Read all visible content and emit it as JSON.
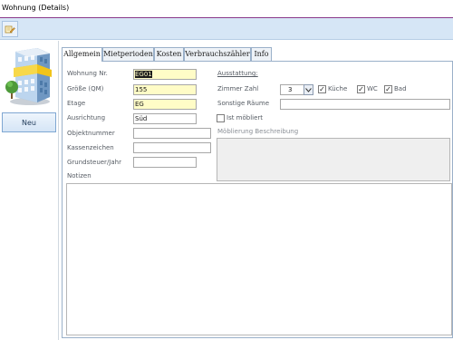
{
  "window": {
    "title": "Wohnung (Details)"
  },
  "toolbar": {
    "icon": "edit-record-icon"
  },
  "left": {
    "new_label": "Neu",
    "image_icon": "apartment-building-icon"
  },
  "tabs": [
    {
      "label": "Allgemein",
      "active": true
    },
    {
      "label": "Mietperioden",
      "active": false
    },
    {
      "label": "Kosten",
      "active": false
    },
    {
      "label": "Verbrauchszähler",
      "active": false
    },
    {
      "label": "Info",
      "active": false
    }
  ],
  "form": {
    "wohnung_nr": {
      "label": "Wohnung Nr.",
      "value": "EG01"
    },
    "groesse": {
      "label": "Größe (QM)",
      "value": "155"
    },
    "etage": {
      "label": "Etage",
      "value": "EG"
    },
    "ausrichtung": {
      "label": "Ausrichtung",
      "value": "Süd"
    },
    "objektnummer": {
      "label": "Objektnummer",
      "value": ""
    },
    "kassenzeichen": {
      "label": "Kassenzeichen",
      "value": ""
    },
    "grundsteuer": {
      "label": "Grundsteuer/Jahr",
      "value": ""
    },
    "notizen": {
      "label": "Notizen",
      "value": ""
    },
    "ausstattung_heading": "Ausstattung:",
    "zimmer_zahl": {
      "label": "Zimmer Zahl",
      "value": "3"
    },
    "kueche": {
      "label": "Küche",
      "checked": true
    },
    "wc": {
      "label": "WC",
      "checked": true
    },
    "bad": {
      "label": "Bad",
      "checked": true
    },
    "sonstige": {
      "label": "Sonstige Räume",
      "value": ""
    },
    "moebliert": {
      "label": "Ist möbliert",
      "checked": false
    },
    "moeblierung_beschreibung": {
      "label": "Möblierung Beschreibung",
      "value": ""
    }
  },
  "colors": {
    "required_field": "#fffcc7",
    "toolbar_bg": "#d6e6f6",
    "title_border": "#8a3a8a",
    "tab_border": "#9ab0c9",
    "disabled_area": "#efefef"
  }
}
